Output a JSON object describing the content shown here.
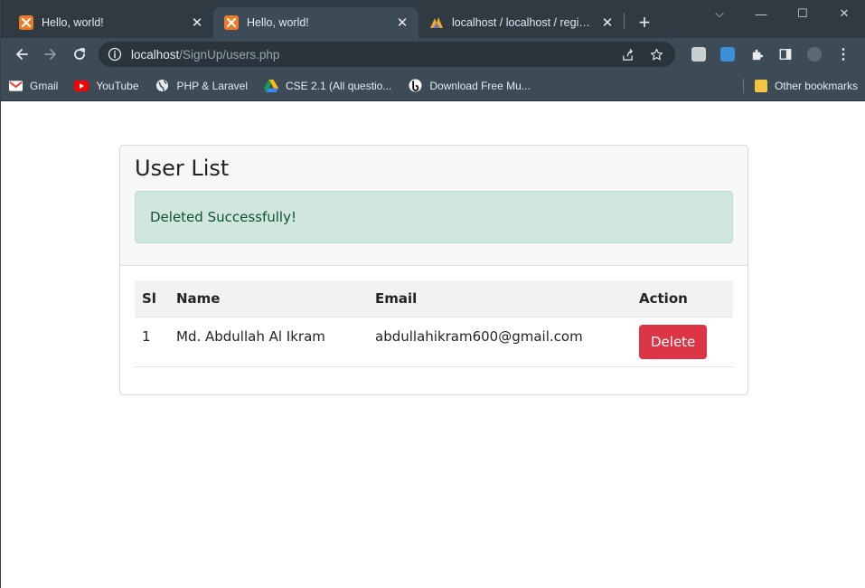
{
  "browser": {
    "tabs": [
      {
        "title": "Hello, world!",
        "active": false
      },
      {
        "title": "Hello, world!",
        "active": true
      },
      {
        "title": "localhost / localhost / register_",
        "active": false
      }
    ],
    "address": {
      "host": "localhost",
      "path": "/SignUp/users.php"
    },
    "bookmarks": [
      {
        "label": "Gmail",
        "icon": "gmail-icon"
      },
      {
        "label": "YouTube",
        "icon": "youtube-icon"
      },
      {
        "label": "PHP & Laravel",
        "icon": "globe-icon"
      },
      {
        "label": "CSE 2.1 (All questio...",
        "icon": "google-drive-icon"
      },
      {
        "label": "Download Free Mu...",
        "icon": "b-logo-icon"
      }
    ],
    "other_bookmarks": "Other bookmarks"
  },
  "page": {
    "title": "User List",
    "alert": "Deleted Successfully!",
    "table": {
      "headers": [
        "Sl",
        "Name",
        "Email",
        "Action"
      ],
      "rows": [
        {
          "sl": "1",
          "name": "Md. Abdullah Al Ikram",
          "email": "abdullahikram600@gmail.com",
          "action": "Delete"
        }
      ]
    }
  },
  "colors": {
    "danger": "#dc3545",
    "alert_bg": "#d1e7dd",
    "alert_text": "#0f5132"
  }
}
